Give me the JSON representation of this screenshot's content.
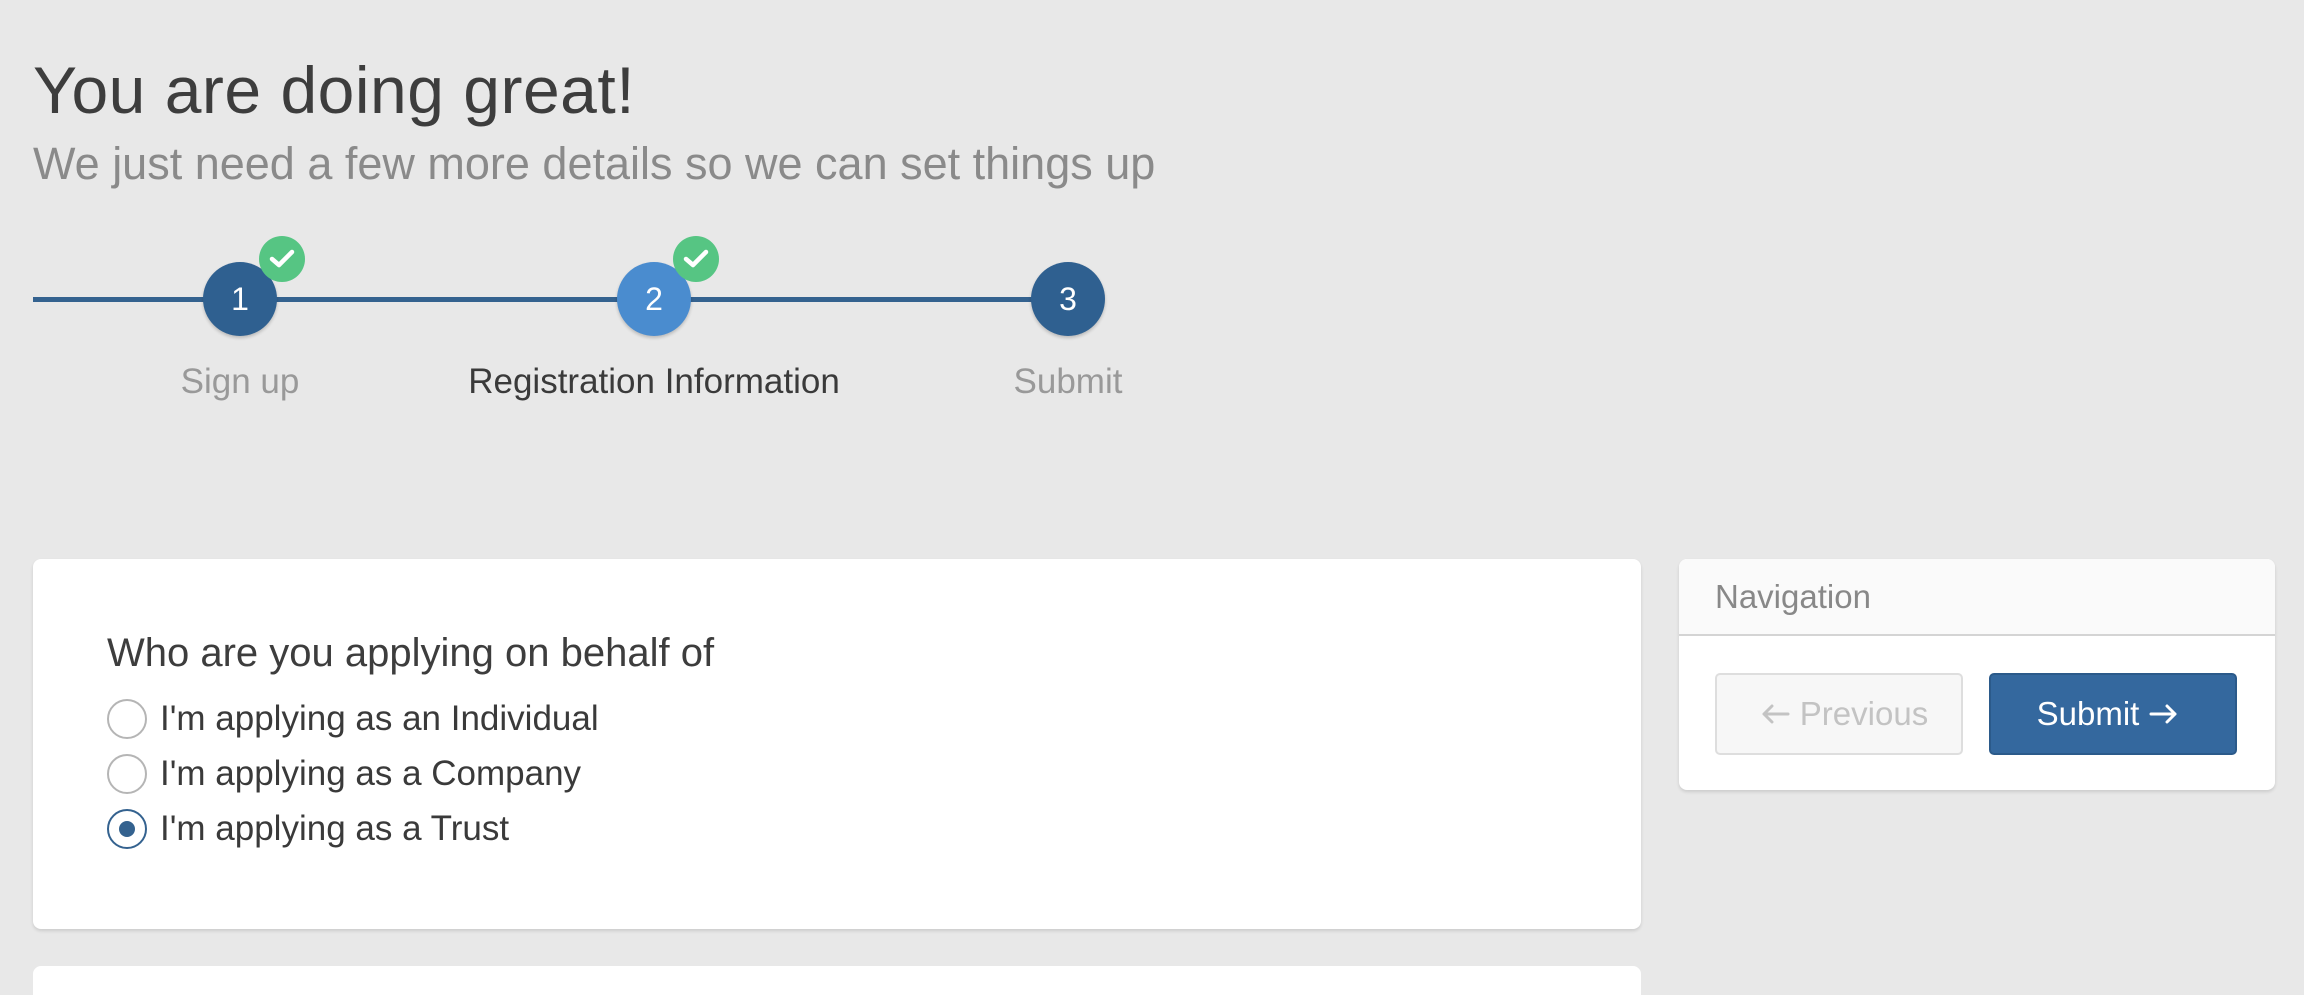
{
  "header": {
    "title": "You are doing great!",
    "subtitle": "We just need a few more details so we can set things up"
  },
  "stepper": {
    "steps": [
      {
        "number": "1",
        "label": "Sign up",
        "completed": true,
        "active": false
      },
      {
        "number": "2",
        "label": "Registration Information",
        "completed": true,
        "active": true
      },
      {
        "number": "3",
        "label": "Submit",
        "completed": false,
        "active": false
      }
    ]
  },
  "form": {
    "question": "Who are you applying on behalf of",
    "options": [
      {
        "label": "I'm applying as an Individual",
        "checked": false
      },
      {
        "label": "I'm applying as a Company",
        "checked": false
      },
      {
        "label": "I'm applying as a Trust",
        "checked": true
      }
    ]
  },
  "navigation": {
    "title": "Navigation",
    "previous_label": "Previous",
    "submit_label": "Submit"
  },
  "icons": {
    "check": "check-icon",
    "arrow_left": "arrow-left-icon",
    "arrow_right": "arrow-right-icon"
  },
  "colors": {
    "background": "#e8e8e8",
    "primary": "#34628f",
    "step_active": "#4a8ccf",
    "check_green": "#56c583",
    "submit_button": "#34689e"
  }
}
